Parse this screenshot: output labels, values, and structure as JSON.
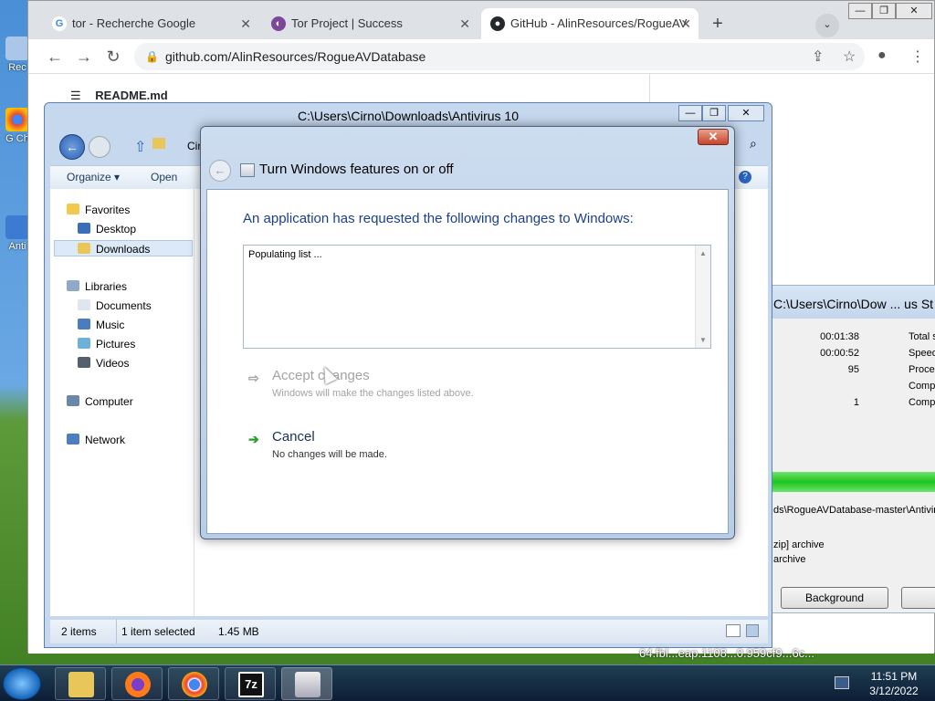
{
  "desktop": {
    "icons": [
      {
        "label": "Rec"
      },
      {
        "label": "G Ch"
      },
      {
        "label": "Anti"
      }
    ]
  },
  "browser": {
    "tabs": [
      {
        "title": "tor - Recherche Google",
        "icon": "google-icon"
      },
      {
        "title": "Tor Project | Success",
        "icon": "tor-icon"
      },
      {
        "title": "GitHub - AlinResources/RogueAV",
        "icon": "github-icon"
      }
    ],
    "new_tab": "+",
    "tab_menu": "⌄",
    "url": "github.com/AlinResources/RogueAVDatabase",
    "readme": "README.md",
    "window_controls": {
      "minimize": "—",
      "maximize": "❐",
      "close": "✕"
    }
  },
  "explorer": {
    "title": "C:\\Users\\Cirno\\Downloads\\Antivirus 10",
    "commands": {
      "organize": "Organize ▾",
      "open": "Open"
    },
    "address_crumb": "Cirno",
    "favorites": {
      "header": "Favorites",
      "items": [
        "Desktop",
        "Downloads"
      ]
    },
    "libraries": {
      "header": "Libraries",
      "items": [
        "Documents",
        "Music",
        "Pictures",
        "Videos"
      ]
    },
    "computer": "Computer",
    "network": "Network",
    "status": {
      "items": "2 items",
      "selected": "1 item selected",
      "size": "1.45 MB"
    }
  },
  "zip": {
    "title": "C:\\Users\\Cirno\\Dow ... us St",
    "rows": [
      {
        "value": "00:01:38",
        "label": "Total s"
      },
      {
        "value": "00:00:52",
        "label": "Speed"
      },
      {
        "value": "95",
        "label": "Proces"
      },
      {
        "value": "",
        "label": "Compr"
      },
      {
        "value": "1",
        "label": "Compr"
      }
    ],
    "path": "ds\\RogueAVDatabase-master\\Antivir",
    "archive1": "zip] archive",
    "archive2": "archive",
    "background_button": "Background"
  },
  "dialog": {
    "close": "✕",
    "title": "Turn Windows features on or off",
    "instruction": "An application has requested the following changes to Windows:",
    "list_text": "Populating list ...",
    "accept": {
      "label": "Accept changes",
      "note": "Windows will make the changes listed above."
    },
    "cancel": {
      "label": "Cancel",
      "note": "No changes will be made."
    }
  },
  "taskbar": {
    "time": "11:51 PM",
    "date": "3/12/2022",
    "background_text": "64.fbl...eap.1108...0.959cf9...6c..."
  }
}
